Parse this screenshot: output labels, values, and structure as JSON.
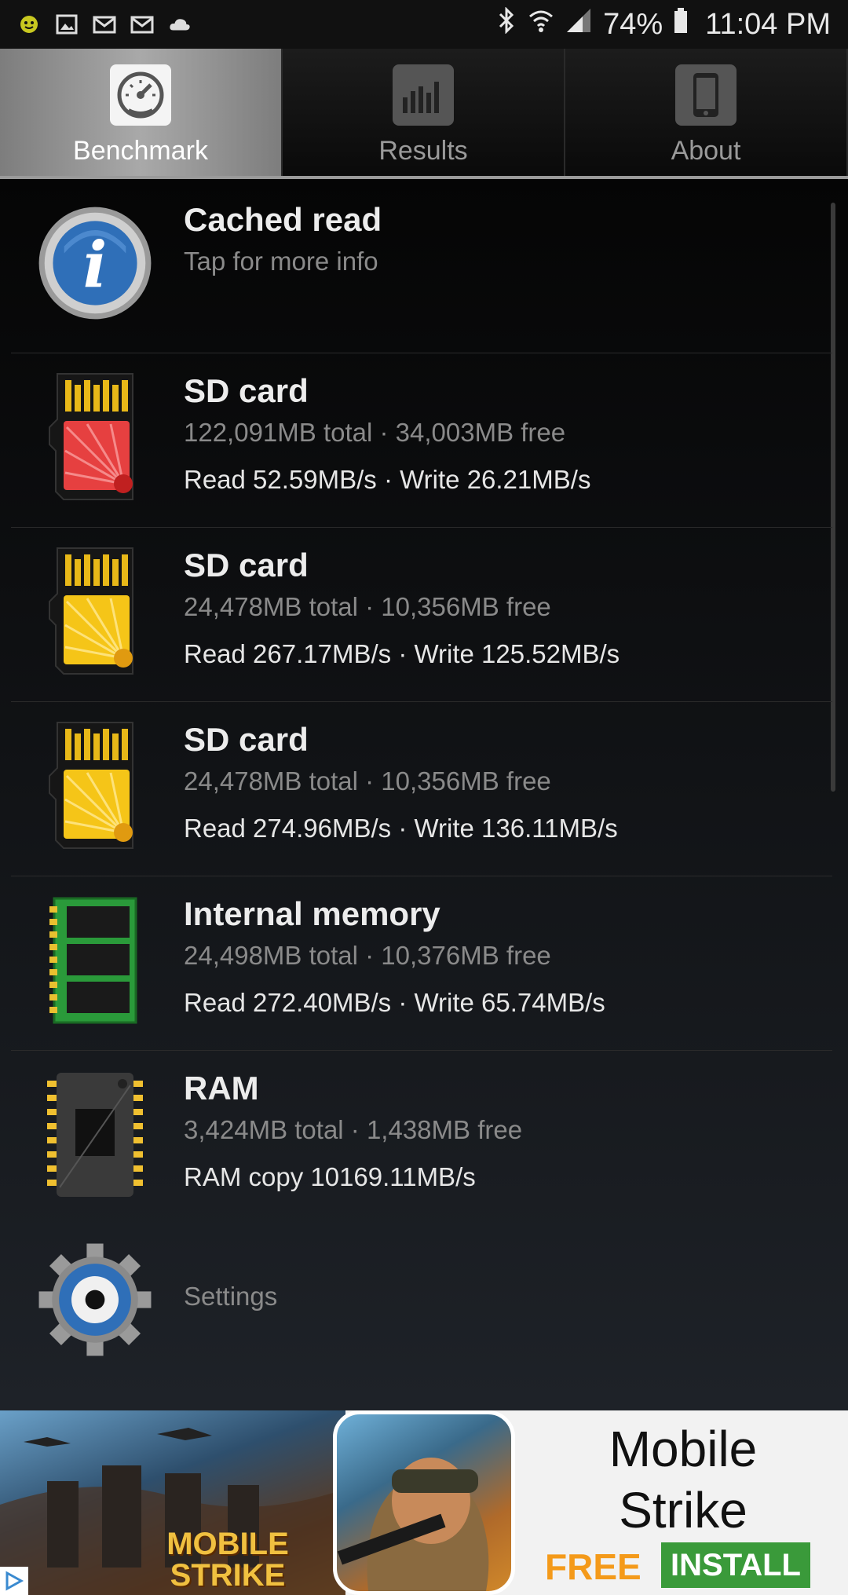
{
  "status_bar": {
    "battery_percent": "74%",
    "time": "11:04 PM",
    "left_icons": [
      "smiley-notification-icon",
      "image-icon",
      "gmail-icon",
      "gmail-icon",
      "cloud-icon"
    ],
    "right_icons": [
      "bluetooth-icon",
      "wifi-icon",
      "signal-icon",
      "battery-icon"
    ]
  },
  "tabs": [
    {
      "label": "Benchmark",
      "icon": "speedometer-icon",
      "active": true
    },
    {
      "label": "Results",
      "icon": "bar-chart-icon",
      "active": false
    },
    {
      "label": "About",
      "icon": "phone-icon",
      "active": false
    }
  ],
  "list": {
    "cached": {
      "title": "Cached read",
      "subtitle": "Tap for more info",
      "icon": "info-icon"
    },
    "items": [
      {
        "title": "SD card",
        "subtitle": "122,091MB total · 34,003MB free",
        "speed": "Read 52.59MB/s · Write 26.21MB/s",
        "icon": "sd-card-red-icon",
        "color": "#e64040"
      },
      {
        "title": "SD card",
        "subtitle": "24,478MB total · 10,356MB free",
        "speed": "Read 267.17MB/s · Write 125.52MB/s",
        "icon": "sd-card-yellow-icon",
        "color": "#f5c518"
      },
      {
        "title": "SD card",
        "subtitle": "24,478MB total · 10,356MB free",
        "speed": "Read 274.96MB/s · Write 136.11MB/s",
        "icon": "sd-card-yellow-icon",
        "color": "#f5c518"
      },
      {
        "title": "Internal memory",
        "subtitle": "24,498MB total · 10,376MB free",
        "speed": "Read 272.40MB/s · Write 65.74MB/s",
        "icon": "memory-chip-icon",
        "color": "#2a9a3a"
      },
      {
        "title": "RAM",
        "subtitle": "3,424MB total · 1,438MB free",
        "speed": "RAM copy 10169.11MB/s",
        "icon": "ram-chip-icon",
        "color": "#f0c030"
      }
    ],
    "settings": {
      "label": "Settings",
      "icon": "gear-icon"
    }
  },
  "ad": {
    "logo_text": "MOBILE STRIKE",
    "title": "Mobile Strike",
    "free": "FREE",
    "install": "INSTALL"
  }
}
